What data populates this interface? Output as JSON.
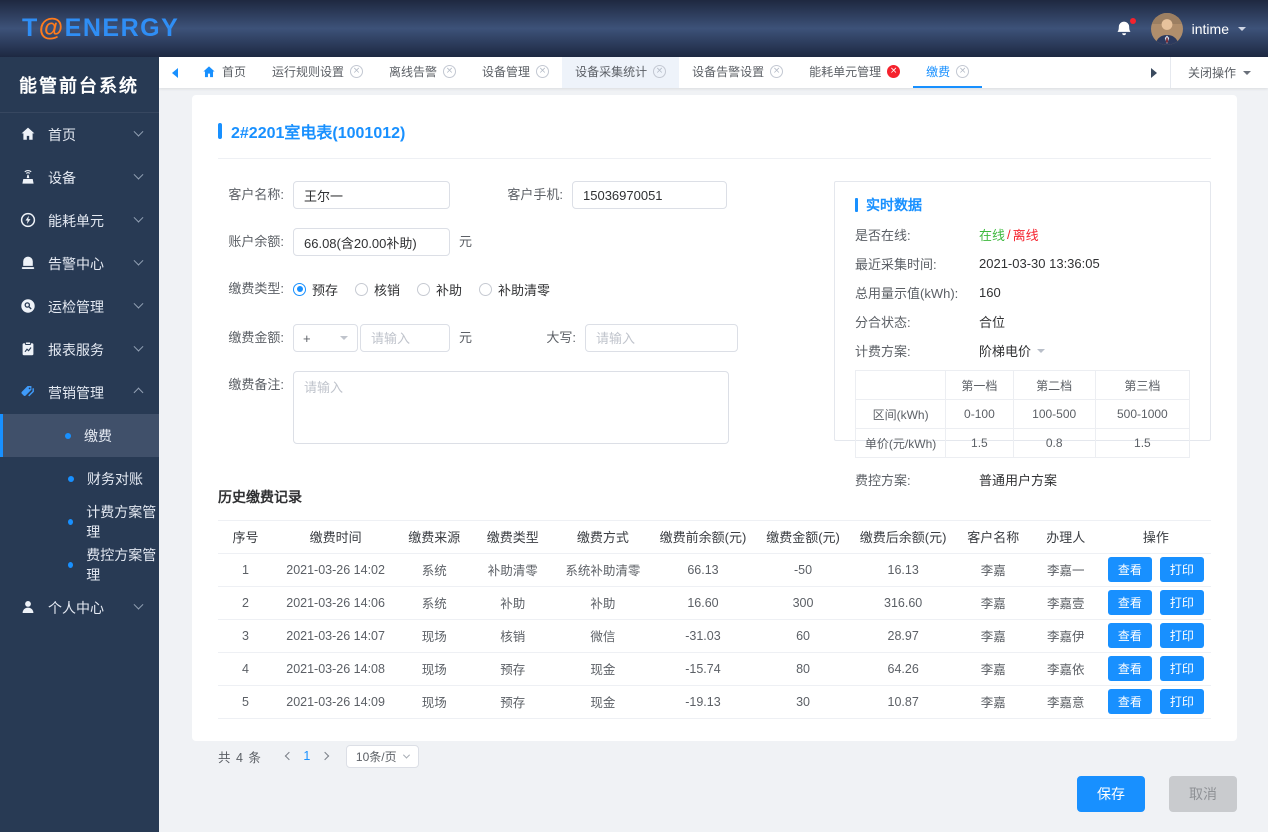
{
  "colors": {
    "accent": "#1890ff",
    "online_green": "#3eb93e",
    "offline_red": "#f5222d",
    "logo_blue": "#2f8ef5",
    "logo_orange": "#ff7b1c",
    "sidebar_bg": "#283a54"
  },
  "header": {
    "logo_t": "T",
    "logo_at": "@",
    "logo_rest": "ENERGY",
    "user_name": "intime"
  },
  "sidebar": {
    "title": "能管前台系统",
    "items": [
      {
        "id": "home",
        "icon": "home",
        "label": "首页"
      },
      {
        "id": "device",
        "icon": "device",
        "label": "设备"
      },
      {
        "id": "energy-unit",
        "icon": "energy",
        "label": "能耗单元"
      },
      {
        "id": "alarm-center",
        "icon": "alarm",
        "label": "告警中心"
      },
      {
        "id": "inspection-mgmt",
        "icon": "inspection",
        "label": "运检管理"
      },
      {
        "id": "report-service",
        "icon": "report",
        "label": "报表服务"
      },
      {
        "id": "marketing-mgmt",
        "icon": "marketing",
        "label": "营销管理",
        "expanded": true,
        "icon_color": "#3f9bfa",
        "children": [
          {
            "id": "payment",
            "label": "缴费",
            "active": true
          },
          {
            "id": "finance-reconcile",
            "label": "财务对账"
          },
          {
            "id": "billing-plan-mgmt",
            "label": "计费方案管理"
          },
          {
            "id": "fee-control-plan-mgmt",
            "label": "费控方案管理"
          }
        ]
      },
      {
        "id": "personal-center",
        "icon": "user",
        "label": "个人中心"
      }
    ]
  },
  "tabbar": {
    "tabs": [
      {
        "id": "home",
        "label": "首页",
        "home": true
      },
      {
        "id": "run-rule-settings",
        "label": "运行规则设置",
        "closable": true
      },
      {
        "id": "offline-alarm",
        "label": "离线告警",
        "closable": true
      },
      {
        "id": "device-mgmt",
        "label": "设备管理",
        "closable": true
      },
      {
        "id": "device-collect-stats",
        "label": "设备采集统计",
        "closable": true,
        "tinted": true
      },
      {
        "id": "device-alarm-settings",
        "label": "设备告警设置",
        "closable": true
      },
      {
        "id": "energy-unit-mgmt",
        "label": "能耗单元管理",
        "closable": true,
        "close_red": true
      },
      {
        "id": "payment",
        "label": "缴费",
        "closable": true,
        "active": true
      }
    ],
    "close_ops_label": "关闭操作"
  },
  "page": {
    "title": "2#2201室电表(1001012)",
    "form": {
      "customer_name": {
        "label": "客户名称:",
        "value": "王尔一"
      },
      "customer_phone": {
        "label": "客户手机:",
        "value": "15036970051"
      },
      "balance": {
        "label": "账户余额:",
        "value": "66.08(含20.00补助)",
        "unit": "元"
      },
      "pay_type": {
        "label": "缴费类型:",
        "selected": "预存",
        "options": [
          {
            "id": "prepay",
            "label": "预存"
          },
          {
            "id": "write-off",
            "label": "核销"
          },
          {
            "id": "subsidy",
            "label": "补助"
          },
          {
            "id": "subsidy-clear",
            "label": "补助清零"
          }
        ]
      },
      "pay_amount": {
        "label": "缴费金额:",
        "sign": "+",
        "placeholder": "请输入",
        "unit": "元"
      },
      "amount_caps": {
        "label": "大写:",
        "placeholder": "请输入"
      },
      "remark": {
        "label": "缴费备注:",
        "placeholder": "请输入"
      }
    },
    "realtime": {
      "title": "实时数据",
      "online_status": {
        "label": "是否在线:",
        "online": "在线",
        "sep": "/",
        "offline": "离线"
      },
      "last_collect": {
        "label": "最近采集时间:",
        "value": "2021-03-30 13:36:05"
      },
      "total_usage": {
        "label": "总用量示值(kWh):",
        "value": "160"
      },
      "switch_state": {
        "label": "分合状态:",
        "value": "合位"
      },
      "billing_plan": {
        "label": "计费方案:",
        "value": "阶梯电价"
      },
      "tier_table": {
        "headers": [
          "",
          "第一档",
          "第二档",
          "第三档"
        ],
        "rows": [
          {
            "label": "区间(kWh)",
            "values": [
              "0-100",
              "100-500",
              "500-1000"
            ]
          },
          {
            "label": "单价(元/kWh)",
            "values": [
              "1.5",
              "0.8",
              "1.5"
            ]
          }
        ]
      },
      "fee_plan": {
        "label": "费控方案:",
        "value": "普通用户方案"
      }
    },
    "history": {
      "title": "历史缴费记录",
      "columns": [
        "序号",
        "缴费时间",
        "缴费来源",
        "缴费类型",
        "缴费方式",
        "缴费前余额(元)",
        "缴费金额(元)",
        "缴费后余额(元)",
        "客户名称",
        "办理人",
        "操作"
      ],
      "rows": [
        [
          "1",
          "2021-03-26 14:02",
          "系统",
          "补助清零",
          "系统补助清零",
          "66.13",
          "-50",
          "16.13",
          "李嘉",
          "李嘉一"
        ],
        [
          "2",
          "2021-03-26 14:06",
          "系统",
          "补助",
          "补助",
          "16.60",
          "300",
          "316.60",
          "李嘉",
          "李嘉壹"
        ],
        [
          "3",
          "2021-03-26 14:07",
          "现场",
          "核销",
          "微信",
          "-31.03",
          "60",
          "28.97",
          "李嘉",
          "李嘉伊"
        ],
        [
          "4",
          "2021-03-26 14:08",
          "现场",
          "预存",
          "现金",
          "-15.74",
          "80",
          "64.26",
          "李嘉",
          "李嘉依"
        ],
        [
          "5",
          "2021-03-26 14:09",
          "现场",
          "预存",
          "现金",
          "-19.13",
          "30",
          "10.87",
          "李嘉",
          "李嘉意"
        ]
      ],
      "actions": {
        "view": "查看",
        "print": "打印"
      },
      "pagination": {
        "total": "共 4 条",
        "page": "1",
        "page_size": "10条/页"
      }
    },
    "footer": {
      "save": "保存",
      "cancel": "取消"
    }
  }
}
